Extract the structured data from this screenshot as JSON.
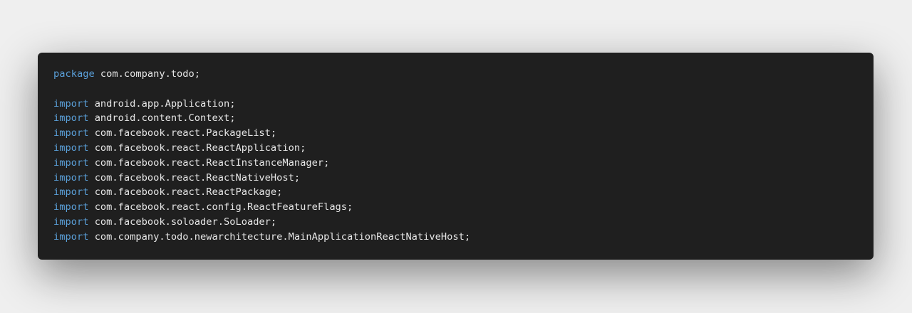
{
  "colors": {
    "keyword": "#5a9fd8",
    "text": "#e6e6e6",
    "background": "#1f1f1f"
  },
  "code_lines": [
    {
      "keyword": "package",
      "rest": " com.company.todo;"
    },
    {
      "keyword": "",
      "rest": ""
    },
    {
      "keyword": "import",
      "rest": " android.app.Application;"
    },
    {
      "keyword": "import",
      "rest": " android.content.Context;"
    },
    {
      "keyword": "import",
      "rest": " com.facebook.react.PackageList;"
    },
    {
      "keyword": "import",
      "rest": " com.facebook.react.ReactApplication;"
    },
    {
      "keyword": "import",
      "rest": " com.facebook.react.ReactInstanceManager;"
    },
    {
      "keyword": "import",
      "rest": " com.facebook.react.ReactNativeHost;"
    },
    {
      "keyword": "import",
      "rest": " com.facebook.react.ReactPackage;"
    },
    {
      "keyword": "import",
      "rest": " com.facebook.react.config.ReactFeatureFlags;"
    },
    {
      "keyword": "import",
      "rest": " com.facebook.soloader.SoLoader;"
    },
    {
      "keyword": "import",
      "rest": " com.company.todo.newarchitecture.MainApplicationReactNativeHost;"
    }
  ]
}
